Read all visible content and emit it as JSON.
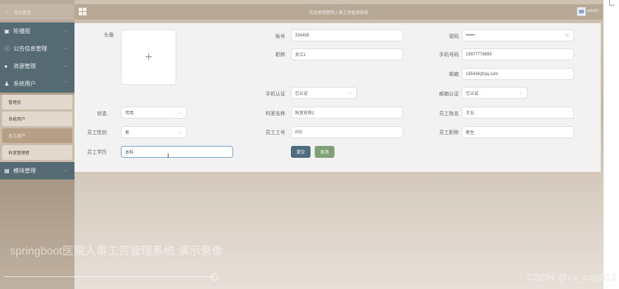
{
  "header": {
    "title": "欢迎使用医院人事工资管理系统",
    "user": "admin"
  },
  "sidebar": {
    "home": "后台首页",
    "menu": [
      {
        "label": "轮播图",
        "icon": "image-icon"
      },
      {
        "label": "公告信息管理",
        "icon": "info-icon"
      },
      {
        "label": "资源管理",
        "icon": "location-icon"
      },
      {
        "label": "系统用户",
        "icon": "user-icon"
      }
    ],
    "submenu": [
      "管理员",
      "系统用户",
      "员工用户",
      "科室管理者"
    ],
    "active_submenu": "员工用户",
    "last_menu": {
      "label": "模块管理",
      "icon": "grid-icon"
    }
  },
  "form": {
    "avatar_label": "头像",
    "upload_symbol": "+",
    "account_label": "账号",
    "account_value": "334455",
    "password_label": "密码",
    "password_value": "••••••",
    "role_label": "职称",
    "role_value": "员工1",
    "phone_label": "手机号码",
    "phone_value": "18977778899",
    "email_label": "邮箱",
    "email_value": "165434@qq.com",
    "phone_verify_label": "手机认证",
    "phone_verify_value": "已认证",
    "email_verify_label": "邮箱认证",
    "email_verify_value": "已认证",
    "status_label": "状态",
    "status_value": "可用",
    "dept_label": "科室名称",
    "dept_value": "科室名称1",
    "name_label": "员工姓名",
    "name_value": "王五",
    "gender_label": "员工性别",
    "gender_value": "男",
    "emp_no_label": "员工工号",
    "emp_no_value": "003",
    "title_label": "员工职称",
    "title_value": "新生",
    "edu_label": "员工学历",
    "edu_value": "本科",
    "submit": "提交",
    "cancel": "取消"
  },
  "watermark": "springboot医院人事工资管理系统 演示录像",
  "credit": "CSDN @vx_cxsj813"
}
